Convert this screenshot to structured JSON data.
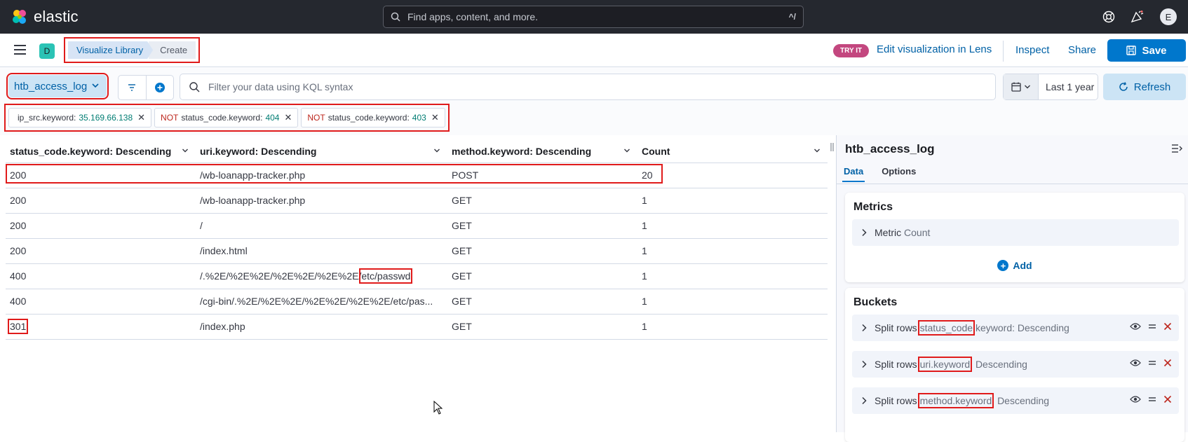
{
  "colors": {
    "accent": "#0077cc",
    "danger": "#e01b1b",
    "topbar": "#25282f",
    "try_badge": "#c3477f"
  },
  "topbar": {
    "brand": "elastic",
    "search_placeholder": "Find apps, content, and more.",
    "search_shortcut": "^/",
    "icons": [
      "help-icon",
      "newsfeed-icon",
      "user-avatar"
    ],
    "avatar_initial": "E"
  },
  "header": {
    "space_initial": "D",
    "breadcrumbs": [
      "Visualize Library",
      "Create"
    ],
    "try_it": "TRY IT",
    "lens_link": "Edit visualization in Lens",
    "inspect": "Inspect",
    "share": "Share",
    "save": "Save"
  },
  "query": {
    "data_view": "htb_access_log",
    "kql_placeholder": "Filter your data using KQL syntax",
    "time_range": "Last 1 year",
    "refresh": "Refresh"
  },
  "filters": [
    {
      "not": "",
      "field": "ip_src.keyword:",
      "value": "35.169.66.138"
    },
    {
      "not": "NOT",
      "field": "status_code.keyword:",
      "value": "404"
    },
    {
      "not": "NOT",
      "field": "status_code.keyword:",
      "value": "403"
    }
  ],
  "table": {
    "columns": [
      "status_code.keyword: Descending",
      "uri.keyword: Descending",
      "method.keyword: Descending",
      "Count"
    ],
    "rows": [
      [
        "200",
        "/wb-loanapp-tracker.php",
        "POST",
        "20"
      ],
      [
        "200",
        "/wb-loanapp-tracker.php",
        "GET",
        "1"
      ],
      [
        "200",
        "/",
        "GET",
        "1"
      ],
      [
        "200",
        "/index.html",
        "GET",
        "1"
      ],
      [
        "400",
        "/.%2E/%2E%2E/%2E%2E/%2E%2E/etc/passwd",
        "GET",
        "1"
      ],
      [
        "400",
        "/cgi-bin/.%2E/%2E%2E/%2E%2E/%2E%2E/etc/pas...",
        "GET",
        "1"
      ],
      [
        "301",
        "/index.php",
        "GET",
        "1"
      ]
    ],
    "uri_row5_prefix": "/.%2E/%2E%2E/%2E%2E/%2E%2E/",
    "uri_row5_suffix": "etc/passwd"
  },
  "panel": {
    "title": "htb_access_log",
    "tabs": [
      "Data",
      "Options"
    ],
    "metrics_heading": "Metrics",
    "metric_label": "Metric",
    "metric_value": "Count",
    "add": "Add",
    "buckets_heading": "Buckets",
    "buckets": [
      {
        "prefix": "Split rows",
        "field": "status_code",
        "rest": ".keyword: Descending"
      },
      {
        "prefix": "Split rows",
        "field": "uri.keyword",
        "rest": ": Descending"
      },
      {
        "prefix": "Split rows",
        "field": "method.keyword",
        "rest": ": Descending"
      }
    ]
  }
}
